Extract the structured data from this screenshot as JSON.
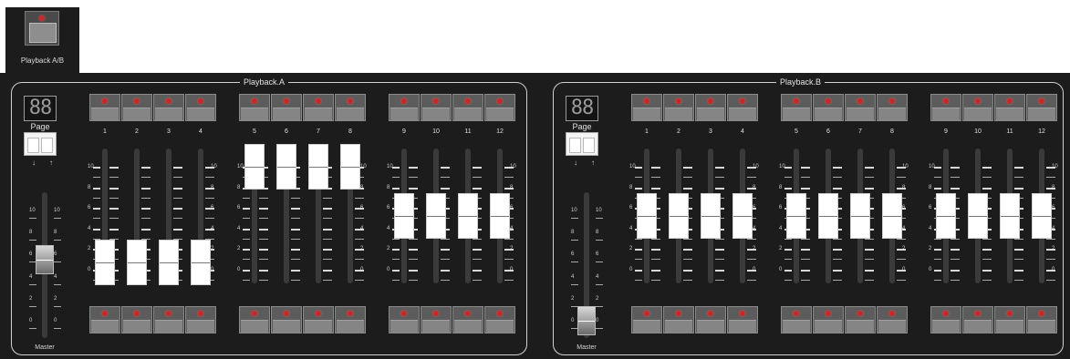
{
  "playback_ab": {
    "label": "Playback A/B"
  },
  "colors": {
    "panel_bg": "#1c1c1c",
    "led": "#c42a2a",
    "fader_knob": "#ffffff",
    "border": "#d0d0d0"
  },
  "scale_labels": [
    "10",
    "8",
    "6",
    "4",
    "2",
    "0"
  ],
  "panels": [
    {
      "title": "Playback.A",
      "display": "88",
      "page_label": "Page",
      "master_label": "Master",
      "master_level": 0.55,
      "page_arrows": [
        "down-arrow-icon",
        "up-arrow-icon"
      ],
      "groups": [
        {
          "channels": [
            "1",
            "2",
            "3",
            "4"
          ],
          "level": 0.07
        },
        {
          "channels": [
            "5",
            "6",
            "7",
            "8"
          ],
          "level": 1.0
        },
        {
          "channels": [
            "9",
            "10",
            "11",
            "12"
          ],
          "level": 0.52
        }
      ]
    },
    {
      "title": "Playback.B",
      "display": "88",
      "page_label": "Page",
      "master_label": "Master",
      "master_level": 0.0,
      "page_arrows": [
        "down-arrow-icon",
        "up-arrow-icon"
      ],
      "groups": [
        {
          "channels": [
            "1",
            "2",
            "3",
            "4"
          ],
          "level": 0.52
        },
        {
          "channels": [
            "5",
            "6",
            "7",
            "8"
          ],
          "level": 0.52
        },
        {
          "channels": [
            "9",
            "10",
            "11",
            "12"
          ],
          "level": 0.52
        }
      ]
    }
  ]
}
